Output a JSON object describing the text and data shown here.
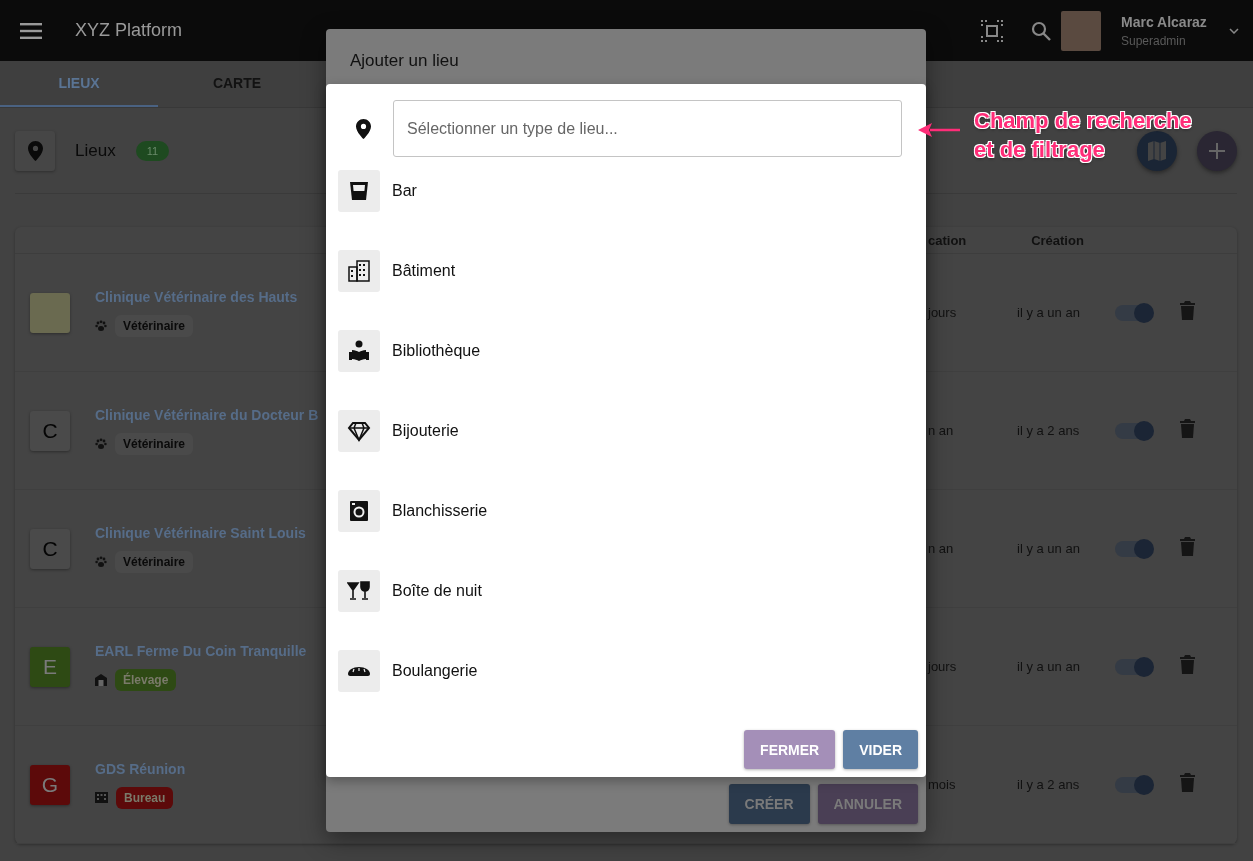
{
  "app_bar": {
    "title": "XYZ Platform",
    "user": {
      "name": "Marc Alcaraz",
      "role": "Superadmin"
    }
  },
  "tabs": [
    {
      "label": "LIEUX",
      "selected": true
    },
    {
      "label": "CARTE",
      "selected": false
    }
  ],
  "header": {
    "title": "Lieux",
    "count": "11"
  },
  "table": {
    "columns": [
      "cation",
      "Création"
    ],
    "rows": [
      {
        "name": "Clinique Vétérinaire des Hauts",
        "avatar": {
          "kind": "photo"
        },
        "category": {
          "label": "Vétérinaire",
          "kind": "paw",
          "color": "#4a4a4a"
        },
        "modified": "jours",
        "created": "il y a un an",
        "active": true
      },
      {
        "name": "Clinique Vétérinaire du Docteur B",
        "avatar": {
          "kind": "letter",
          "initial": "C",
          "color": "#4a4a4a"
        },
        "category": {
          "label": "Vétérinaire",
          "kind": "paw",
          "color": "#4a4a4a"
        },
        "modified": "n an",
        "created": "il y a 2 ans",
        "active": true
      },
      {
        "name": "Clinique Vétérinaire Saint Louis",
        "avatar": {
          "kind": "letter",
          "initial": "C",
          "color": "#4a4a4a"
        },
        "category": {
          "label": "Vétérinaire",
          "kind": "paw",
          "color": "#4a4a4a"
        },
        "modified": "n an",
        "created": "il y a un an",
        "active": true
      },
      {
        "name": "EARL Ferme Du Coin Tranquille",
        "avatar": {
          "kind": "letter",
          "initial": "E",
          "color": "#2e4a14"
        },
        "category": {
          "label": "Élevage",
          "kind": "barn",
          "color": "#2e4a14"
        },
        "modified": "jours",
        "created": "il y a un an",
        "active": true
      },
      {
        "name": "GDS Réunion",
        "avatar": {
          "kind": "letter",
          "initial": "G",
          "color": "#5c0a0a"
        },
        "category": {
          "label": "Bureau",
          "kind": "office",
          "color": "#5c0a0a"
        },
        "modified": "mois",
        "created": "il y a 2 ans",
        "active": true
      }
    ]
  },
  "dialog": {
    "title": "Ajouter un lieu",
    "buttons": [
      {
        "label": "CRÉER",
        "kind": "primary"
      },
      {
        "label": "ANNULER",
        "kind": "secondary"
      }
    ],
    "picker": {
      "placeholder": "Sélectionner un type de lieu...",
      "options": [
        {
          "label": "Bar",
          "kind": "bar"
        },
        {
          "label": "Bâtiment",
          "kind": "building"
        },
        {
          "label": "Bibliothèque",
          "kind": "library"
        },
        {
          "label": "Bijouterie",
          "kind": "jewel"
        },
        {
          "label": "Blanchisserie",
          "kind": "laundry"
        },
        {
          "label": "Boîte de nuit",
          "kind": "club"
        },
        {
          "label": "Boulangerie",
          "kind": "bakery"
        }
      ],
      "buttons": [
        {
          "label": "FERMER",
          "kind": "secondary"
        },
        {
          "label": "VIDER",
          "kind": "primary"
        }
      ]
    }
  },
  "annotation": {
    "lines": [
      "Champ de recherche",
      "et de filtrage"
    ]
  }
}
